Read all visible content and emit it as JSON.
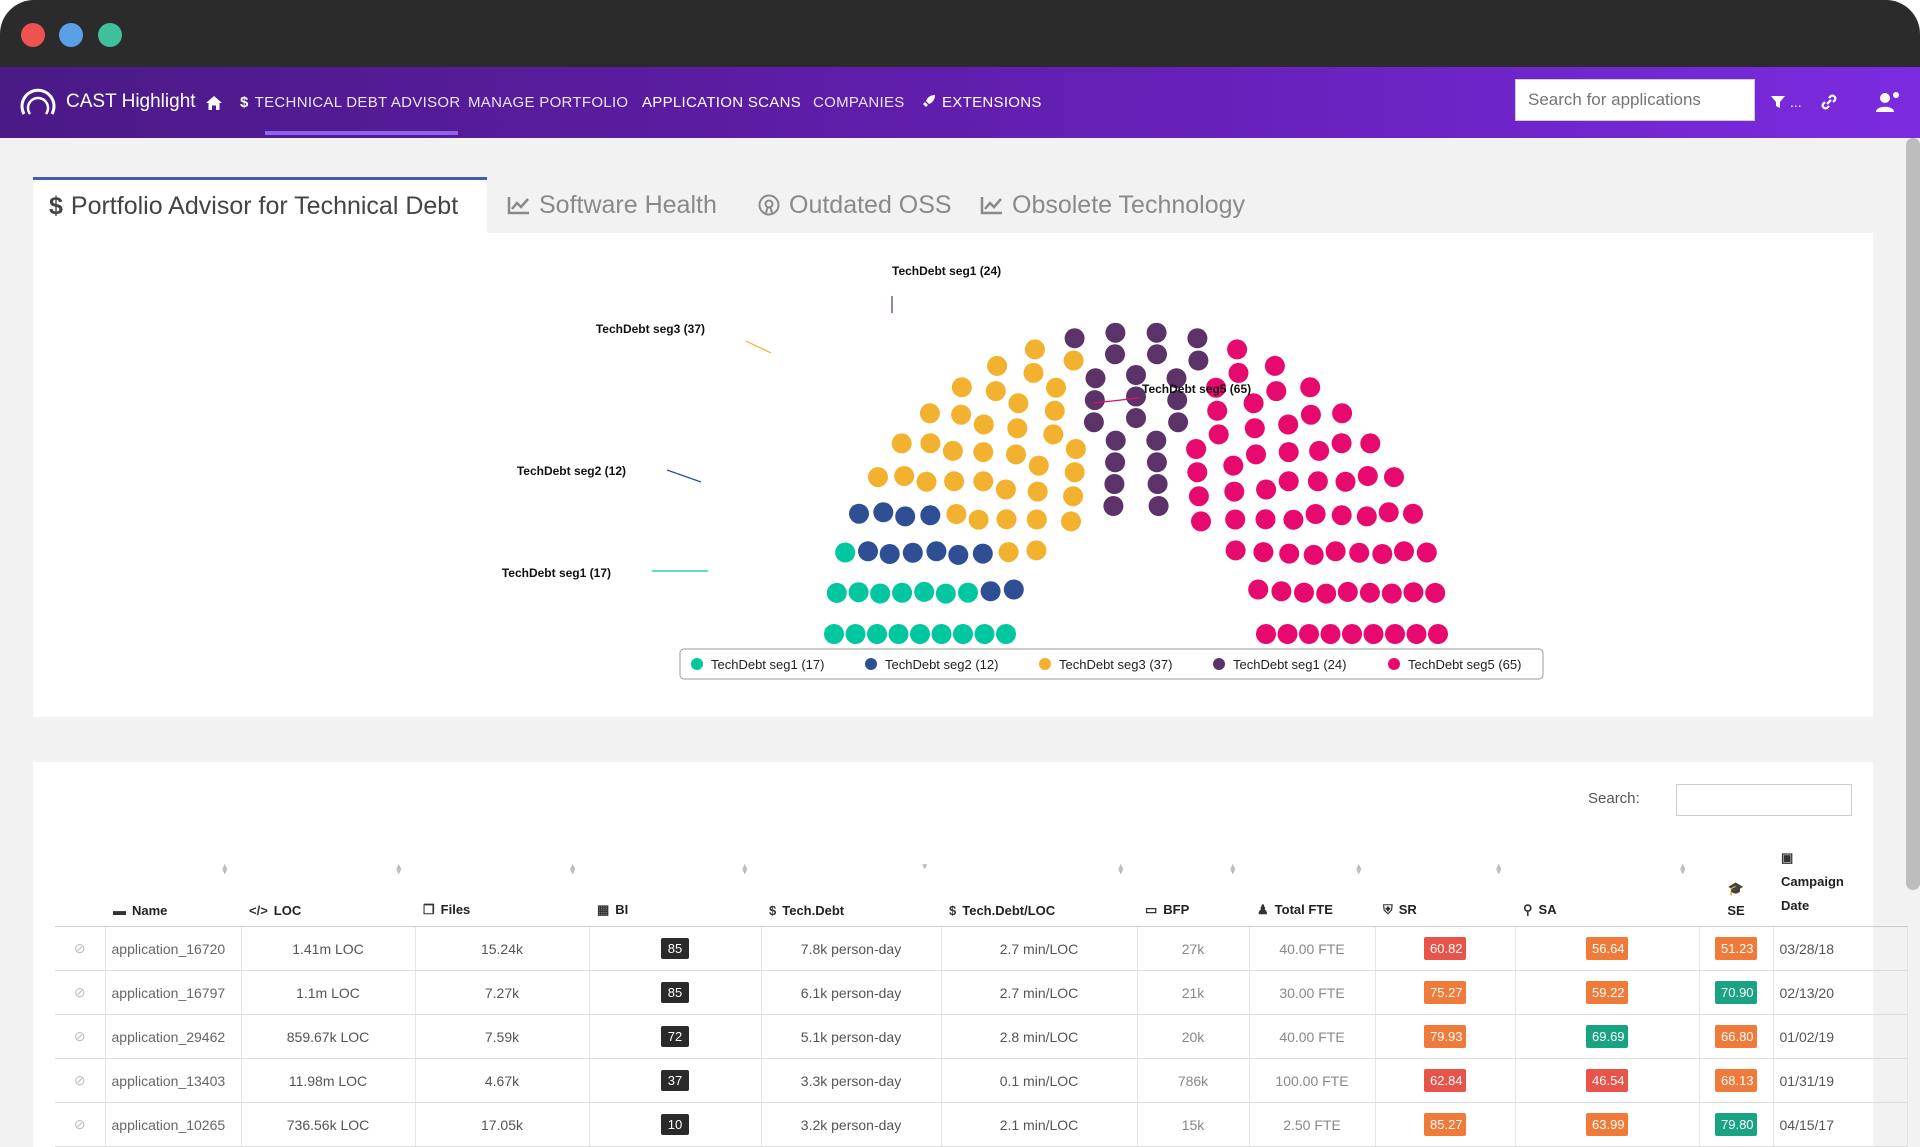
{
  "app": {
    "brand": "CAST Highlight",
    "nav": [
      "TECHNICAL DEBT ADVISOR",
      "MANAGE PORTFOLIO",
      "APPLICATION SCANS",
      "COMPANIES",
      "EXTENSIONS"
    ],
    "search_placeholder": "Search for applications",
    "filter_label": "..."
  },
  "tabs": [
    "Portfolio Advisor for Technical Debt",
    "Software Health",
    "Outdated OSS",
    "Obsolete Technology"
  ],
  "chart_data": {
    "type": "parliament",
    "series": [
      {
        "name": "TechDebt seg1 (17)",
        "value": 17,
        "color": "#00c7a0"
      },
      {
        "name": "TechDebt seg2 (12)",
        "value": 12,
        "color": "#2e4f94"
      },
      {
        "name": "TechDebt seg3 (37)",
        "value": 37,
        "color": "#f2b12f"
      },
      {
        "name": "TechDebt seg1 (24)",
        "value": 24,
        "color": "#5c3368"
      },
      {
        "name": "TechDebt seg5 (65)",
        "value": 65,
        "color": "#e8096e"
      }
    ],
    "legend": "bottom"
  },
  "table": {
    "search_label": "Search:",
    "headers": [
      "Name",
      "LOC",
      "Files",
      "BI",
      "Tech.Debt",
      "Tech.Debt/LOC",
      "BFP",
      "Total FTE",
      "SR",
      "SA",
      "SE",
      "Campaign Date"
    ],
    "rows": [
      {
        "name": "application_16720",
        "loc": "1.41m LOC",
        "files": "15.24k",
        "bi": "85",
        "debt": "7.8k person-day",
        "debt_loc": "2.7 min/LOC",
        "bfp": "27k",
        "fte": "40.00 FTE",
        "sr": "60.82",
        "sa": "56.64",
        "se": "51.23",
        "date": "03/28/18",
        "sr_c": "#e8534a",
        "sa_c": "#f07a3a",
        "se_c": "#f07a3a"
      },
      {
        "name": "application_16797",
        "loc": "1.1m LOC",
        "files": "7.27k",
        "bi": "85",
        "debt": "6.1k person-day",
        "debt_loc": "2.7 min/LOC",
        "bfp": "21k",
        "fte": "30.00 FTE",
        "sr": "75.27",
        "sa": "59.22",
        "se": "70.90",
        "date": "02/13/20",
        "sr_c": "#f07a3a",
        "sa_c": "#f07a3a",
        "se_c": "#1aa383"
      },
      {
        "name": "application_29462",
        "loc": "859.67k LOC",
        "files": "7.59k",
        "bi": "72",
        "debt": "5.1k person-day",
        "debt_loc": "2.8 min/LOC",
        "bfp": "20k",
        "fte": "40.00 FTE",
        "sr": "79.93",
        "sa": "69.69",
        "se": "66.80",
        "date": "01/02/19",
        "sr_c": "#f07a3a",
        "sa_c": "#1aa383",
        "se_c": "#f07a3a"
      },
      {
        "name": "application_13403",
        "loc": "11.98m LOC",
        "files": "4.67k",
        "bi": "37",
        "debt": "3.3k person-day",
        "debt_loc": "0.1 min/LOC",
        "bfp": "786k",
        "fte": "100.00 FTE",
        "sr": "62.84",
        "sa": "46.54",
        "se": "68.13",
        "date": "01/31/19",
        "sr_c": "#e8534a",
        "sa_c": "#e8534a",
        "se_c": "#f07a3a"
      },
      {
        "name": "application_10265",
        "loc": "736.56k LOC",
        "files": "17.05k",
        "bi": "10",
        "debt": "3.2k person-day",
        "debt_loc": "2.1 min/LOC",
        "bfp": "15k",
        "fte": "2.50 FTE",
        "sr": "85.27",
        "sa": "63.99",
        "se": "79.80",
        "date": "04/15/17",
        "sr_c": "#f07a3a",
        "sa_c": "#f07a3a",
        "se_c": "#1aa383"
      }
    ]
  }
}
